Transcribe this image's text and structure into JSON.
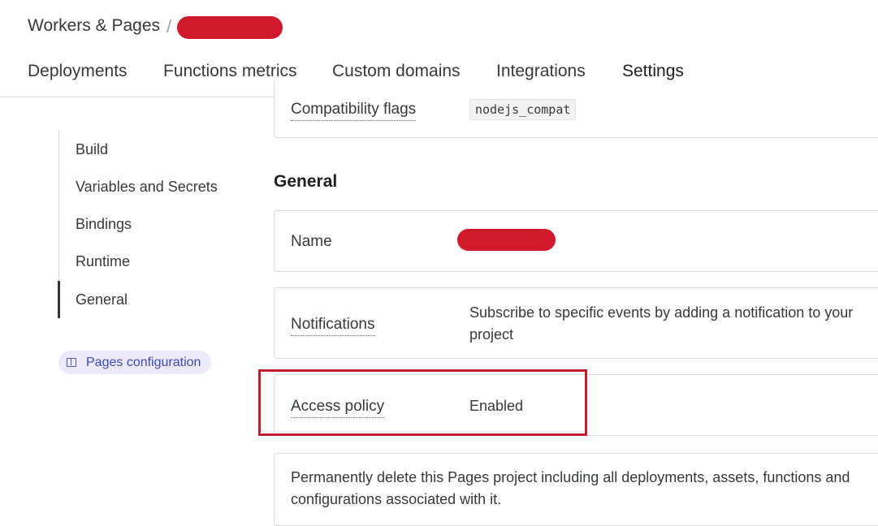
{
  "breadcrumb": {
    "root": "Workers & Pages",
    "separator": "/",
    "project_name_redacted": true
  },
  "tabs": [
    {
      "label": "Deployments",
      "active": false
    },
    {
      "label": "Functions metrics",
      "active": false
    },
    {
      "label": "Custom domains",
      "active": false
    },
    {
      "label": "Integrations",
      "active": false
    },
    {
      "label": "Settings",
      "active": true
    }
  ],
  "sidebar": {
    "items": [
      {
        "label": "Build",
        "active": false
      },
      {
        "label": "Variables and Secrets",
        "active": false
      },
      {
        "label": "Bindings",
        "active": false
      },
      {
        "label": "Runtime",
        "active": false
      },
      {
        "label": "General",
        "active": true
      }
    ],
    "pages_config_label": "Pages configuration"
  },
  "compat": {
    "label": "Compatibility flags",
    "value": "nodejs_compat"
  },
  "general": {
    "heading": "General",
    "name_label": "Name",
    "notifications_label": "Notifications",
    "notifications_desc": "Subscribe to specific events by adding a notification to your project",
    "access_policy_label": "Access policy",
    "access_policy_value": "Enabled",
    "delete_desc": "Permanently delete this Pages project including all deployments, assets, functions and configurations associated with it."
  },
  "colors": {
    "accent": "#0051c3",
    "redaction": "#d0192b",
    "highlight": "#c41e2e",
    "pill_bg": "#ece9fb"
  }
}
